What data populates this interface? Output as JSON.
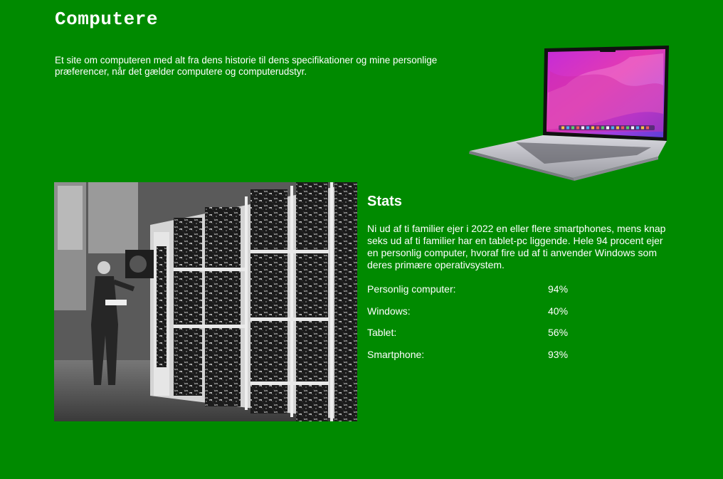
{
  "header": {
    "title": "Computere",
    "intro": "Et site om computeren med alt fra dens historie til dens specifikationer og mine personlige præferencer, når det gælder computere og computerudstyr."
  },
  "images": {
    "laptop": "laptop-image",
    "historic": "historic-computer-photo"
  },
  "stats": {
    "heading": "Stats",
    "description": "Ni ud af ti familier ejer i 2022 en eller flere smartphones, mens knap seks ud af ti familier har en tablet-pc liggende. Hele 94 procent ejer en personlig computer, hvoraf fire ud af ti anvender Windows som deres primære operativsystem.",
    "rows": [
      {
        "label": "Personlig computer:",
        "value": "94%"
      },
      {
        "label": "Windows:",
        "value": "40%"
      },
      {
        "label": "Tablet:",
        "value": "56%"
      },
      {
        "label": "Smartphone:",
        "value": "93%"
      }
    ]
  },
  "colors": {
    "background": "#008a00",
    "text": "#ffffff"
  }
}
